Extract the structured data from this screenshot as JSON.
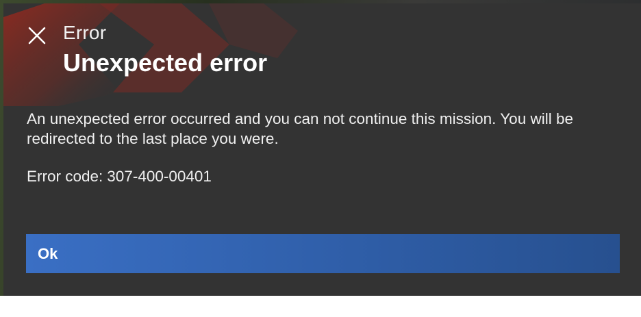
{
  "dialog": {
    "close_icon": "close-icon",
    "eyebrow": "Error",
    "title": "Unexpected error",
    "message": "An unexpected error occurred and you can not continue this mission. You will be redirected to the last place you were.",
    "error_code_label": "Error code:",
    "error_code_value": "307-400-00401",
    "ok_label": "Ok"
  },
  "colors": {
    "dialog_background": "#333333",
    "accent_red": "#8a2a22",
    "button_blue": "#2f5ea8",
    "text": "#ffffff"
  }
}
